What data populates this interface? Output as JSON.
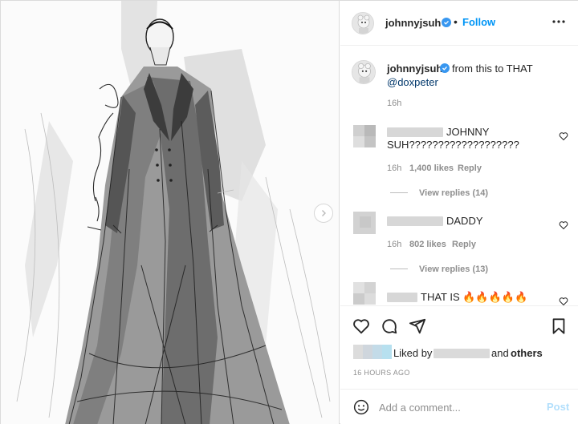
{
  "header": {
    "username": "johnnyjsuh",
    "separator": "•",
    "follow_label": "Follow",
    "more_icon": "more-horizontal-icon"
  },
  "caption": {
    "username": "johnnyjsuh",
    "text": "from this to THAT",
    "mention": "@doxpeter",
    "time": "16h"
  },
  "comments": [
    {
      "text_line1": "JOHNNY",
      "text_line2": "SUH???????????????????",
      "time": "16h",
      "likes": "1,400 likes",
      "reply_label": "Reply",
      "view_replies": "View replies (14)"
    },
    {
      "text_line1": "DADDY",
      "time": "16h",
      "likes": "802 likes",
      "reply_label": "Reply",
      "view_replies": "View replies (13)"
    },
    {
      "text_line1": "THAT IS 🔥🔥🔥🔥🔥"
    }
  ],
  "likes": {
    "prefix": "Liked by",
    "and_label": "and",
    "others_label": "others"
  },
  "post_time": "16 HOURS AGO",
  "comment_box": {
    "placeholder": "Add a comment...",
    "post_label": "Post"
  },
  "colors": {
    "accent": "#0095f6",
    "verified": "#3897f0",
    "muted": "#8e8e8e",
    "post_disabled": "#b2dffc"
  },
  "icons": [
    "chevron-right-icon",
    "verified-badge-icon",
    "heart-icon",
    "comment-icon",
    "share-icon",
    "bookmark-icon",
    "emoji-icon"
  ]
}
